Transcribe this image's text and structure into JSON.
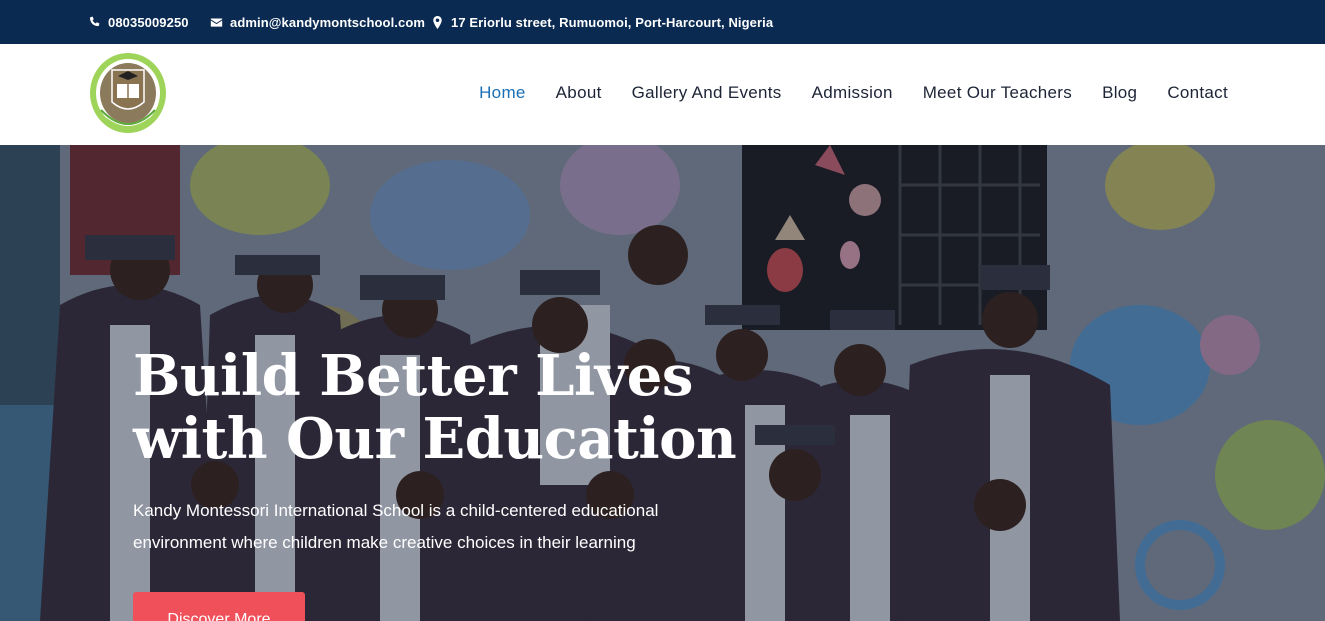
{
  "topbar": {
    "phone": "08035009250",
    "email": "admin@kandymontschool.com",
    "address": "17 Eriorlu street, Rumuomoi, Port-Harcourt, Nigeria",
    "phone_icon": "phone-icon",
    "email_icon": "envelope-icon",
    "address_icon": "map-pin-icon"
  },
  "nav": {
    "items": [
      "Home",
      "About",
      "Gallery And Events",
      "Admission",
      "Meet Our Teachers",
      "Blog",
      "Contact"
    ],
    "active": "Home"
  },
  "hero": {
    "title_line1": "Build Better Lives",
    "title_line2": "with Our Education",
    "description": "Kandy Montessori International School is a child-centered educational environment where children make creative choices in their learning",
    "button": "Discover More"
  },
  "colors": {
    "topbar": "#0b2a52",
    "nav_active": "#1a6fb6",
    "nav_text": "#1c2436",
    "button": "#f0505a"
  }
}
